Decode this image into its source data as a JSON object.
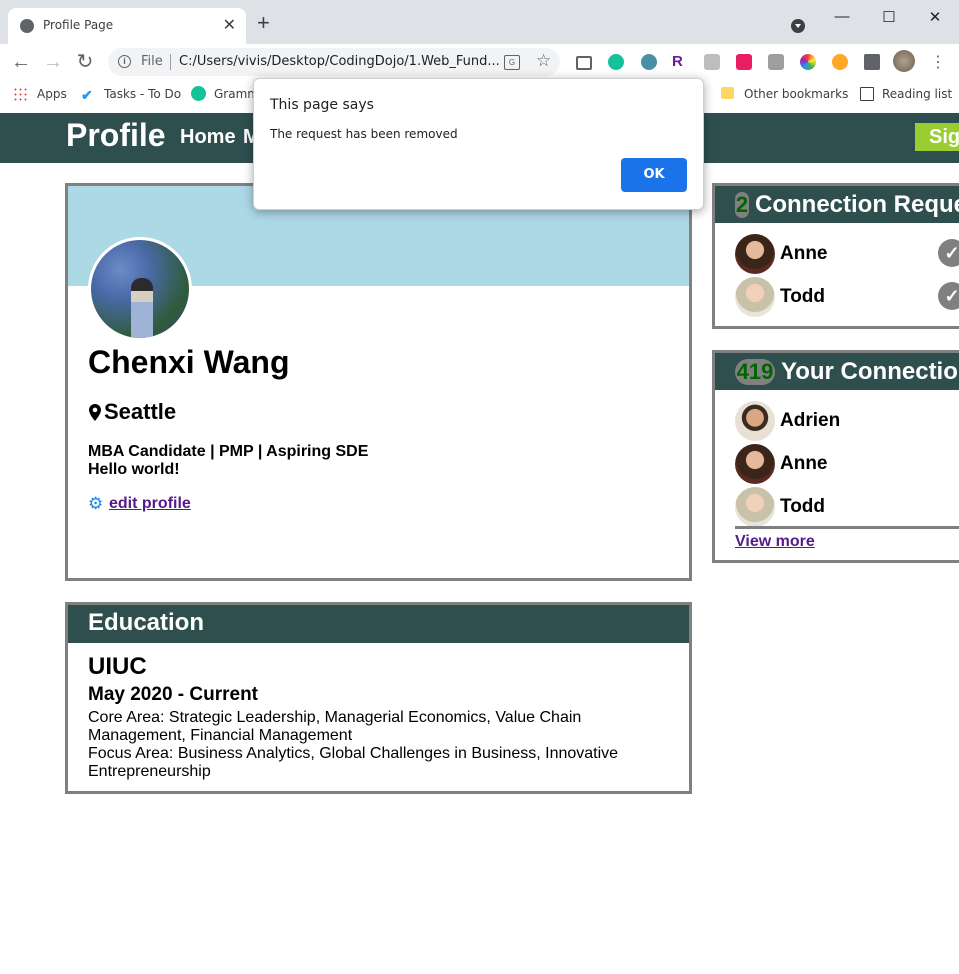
{
  "browser": {
    "tab_title": "Profile Page",
    "tab_close": "✕",
    "new_tab": "+",
    "url_scheme": "File",
    "url": "C:/Users/vivis/Desktop/CodingDojo/1.Web_Fund...",
    "bookmarks": {
      "apps": "Apps",
      "tasks": "Tasks - To Do",
      "grammarly": "Gramm",
      "other": "Other bookmarks",
      "reading_list": "Reading list"
    }
  },
  "dialog": {
    "title": "This page says",
    "message": "The request has been removed",
    "ok_label": "OK"
  },
  "navbar": {
    "brand": "Profile",
    "home": "Home",
    "partial_item": "M",
    "signout_partial": "Sig"
  },
  "profile": {
    "name": "Chenxi Wang",
    "location": "Seattle",
    "headline": "MBA Candidate | PMP | Aspiring SDE",
    "bio": "Hello world!",
    "edit_link": "edit profile"
  },
  "education": {
    "heading": "Education",
    "school": "UIUC",
    "dates": "May 2020 - Current",
    "core_area": "Core Area: Strategic Leadership, Managerial Economics, Value Chain Management, Financial Management",
    "focus_area": "Focus Area: Business Analytics, Global Challenges in Business, Innovative Entrepreneurship"
  },
  "requests": {
    "count": "2",
    "title": "Connection Reque",
    "people": [
      "Anne",
      "Todd"
    ]
  },
  "connections": {
    "count": "419",
    "title": "Your Connectio",
    "people": [
      "Adrien",
      "Anne",
      "Todd"
    ],
    "view_more": "View more"
  },
  "colors": {
    "navbar": "#2f4f4f",
    "banner": "#add8e6",
    "signout": "#9acd32",
    "badge_text": "#006400",
    "dialog_button": "#1a73e8"
  }
}
